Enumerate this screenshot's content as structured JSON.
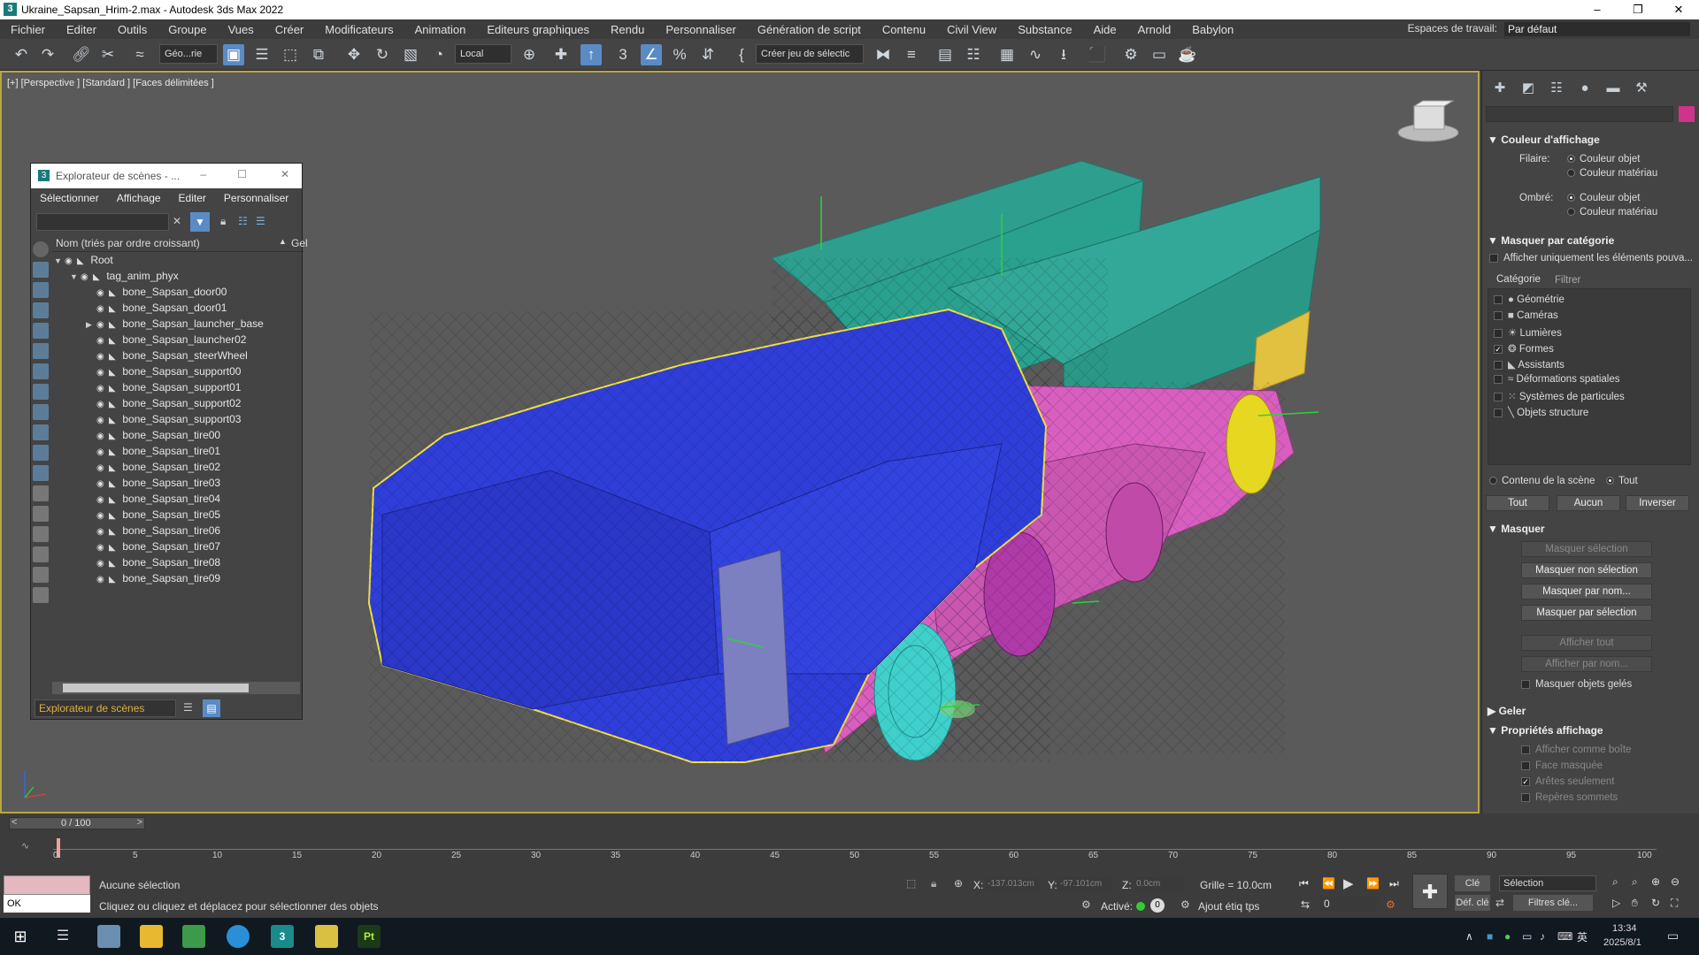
{
  "window": {
    "title": "Ukraine_Sapsan_Hrim-2.max - Autodesk 3ds Max 2022",
    "app_icon_label": "3",
    "minimize_icon": "minimize-icon",
    "maximize_icon": "restore-icon",
    "close_icon": "close-icon"
  },
  "menu": [
    "Fichier",
    "Editer",
    "Outils",
    "Groupe",
    "Vues",
    "Créer",
    "Modificateurs",
    "Animation",
    "Editeurs graphiques",
    "Rendu",
    "Personnaliser",
    "Génération de script",
    "Contenu",
    "Civil View",
    "Substance",
    "Aide",
    "Arnold",
    "Babylon"
  ],
  "workspace": {
    "label": "Espaces de travail:",
    "value": "Par défaut"
  },
  "toolbar": {
    "selection_filter": "Géo...rie",
    "reference_coord": "Local",
    "named_selection": "Créer jeu de sélectic"
  },
  "viewport": {
    "label": "[+] [Perspective ] [Standard ] [Faces délimitées ]"
  },
  "scene_explorer": {
    "title": "Explorateur de scènes - ...",
    "menu": [
      "Sélectionner",
      "Affichage",
      "Editer",
      "Personnaliser"
    ],
    "column_header": "Nom (triés par ordre croissant)",
    "column_header2": "Gel",
    "tree": [
      {
        "label": "Root",
        "level": 0,
        "expanded": true
      },
      {
        "label": "tag_anim_phyx",
        "level": 1,
        "expanded": true
      },
      {
        "label": "bone_Sapsan_door00",
        "level": 2
      },
      {
        "label": "bone_Sapsan_door01",
        "level": 2
      },
      {
        "label": "bone_Sapsan_launcher_base",
        "level": 2,
        "collapsed": true
      },
      {
        "label": "bone_Sapsan_launcher02",
        "level": 2
      },
      {
        "label": "bone_Sapsan_steerWheel",
        "level": 2
      },
      {
        "label": "bone_Sapsan_support00",
        "level": 2
      },
      {
        "label": "bone_Sapsan_support01",
        "level": 2
      },
      {
        "label": "bone_Sapsan_support02",
        "level": 2
      },
      {
        "label": "bone_Sapsan_support03",
        "level": 2
      },
      {
        "label": "bone_Sapsan_tire00",
        "level": 2
      },
      {
        "label": "bone_Sapsan_tire01",
        "level": 2
      },
      {
        "label": "bone_Sapsan_tire02",
        "level": 2
      },
      {
        "label": "bone_Sapsan_tire03",
        "level": 2
      },
      {
        "label": "bone_Sapsan_tire04",
        "level": 2
      },
      {
        "label": "bone_Sapsan_tire05",
        "level": 2
      },
      {
        "label": "bone_Sapsan_tire06",
        "level": 2
      },
      {
        "label": "bone_Sapsan_tire07",
        "level": 2
      },
      {
        "label": "bone_Sapsan_tire08",
        "level": 2
      },
      {
        "label": "bone_Sapsan_tire09",
        "level": 2
      }
    ],
    "footer_dropdown": "Explorateur de scènes"
  },
  "command_panel": {
    "display_color": {
      "heading": "Couleur d'affichage",
      "wireframe_label": "Filaire:",
      "shaded_label": "Ombré:",
      "object_color": "Couleur objet",
      "material_color": "Couleur matériau"
    },
    "hide_by_category": {
      "heading": "Masquer par catégorie",
      "only_show": "Afficher uniquement les éléments pouva...",
      "tabs": [
        "Catégorie",
        "Filtrer"
      ],
      "categories": [
        {
          "label": "Géométrie",
          "checked": false
        },
        {
          "label": "Caméras",
          "checked": false
        },
        {
          "label": "Lumières",
          "checked": false
        },
        {
          "label": "Formes",
          "checked": true
        },
        {
          "label": "Assistants",
          "checked": false
        },
        {
          "label": "Déformations spatiales",
          "checked": false
        },
        {
          "label": "Systèmes de particules",
          "checked": false
        },
        {
          "label": "Objets structure",
          "checked": false
        }
      ],
      "scene_content": "Contenu de la scène",
      "all_radio": "Tout",
      "btn_all": "Tout",
      "btn_none": "Aucun",
      "btn_invert": "Inverser"
    },
    "hide": {
      "heading": "Masquer",
      "buttons": [
        "Masquer sélection",
        "Masquer non sélection",
        "Masquer par nom...",
        "Masquer par sélection",
        "Afficher tout",
        "Afficher par nom..."
      ],
      "hide_frozen": "Masquer objets gelés"
    },
    "freeze": {
      "heading": "Geler"
    },
    "display_props": {
      "heading": "Propriétés affichage",
      "items": [
        "Afficher comme boîte",
        "Face masquée",
        "Arêtes seulement",
        "Repères sommets"
      ]
    }
  },
  "timeline": {
    "frame_display": "0 / 100",
    "ticks": [
      "0",
      "5",
      "10",
      "15",
      "20",
      "25",
      "30",
      "35",
      "40",
      "45",
      "50",
      "55",
      "60",
      "65",
      "70",
      "75",
      "80",
      "85",
      "90",
      "95",
      "100"
    ]
  },
  "status": {
    "selection": "Aucune sélection",
    "prompt": "Cliquez ou cliquez et déplacez pour sélectionner des objets",
    "x_label": "X:",
    "x_value": "-137.013cm",
    "y_label": "Y:",
    "y_value": "-97.101cm",
    "z_label": "Z:",
    "z_value": "0.0cm",
    "grid": "Grille = 10.0cm",
    "auto_key": "Clé auto",
    "set_key": "Déf. clé",
    "selection_dropdown": "Sélection",
    "key_filters": "Filtres clé...",
    "activated": "Activé:",
    "add_time_tag": "Ajout étiq tps",
    "frame_field": "0",
    "maxscript": "OK"
  },
  "taskbar": {
    "time": "13:34",
    "date": "2025/8/1",
    "ime": "英"
  }
}
